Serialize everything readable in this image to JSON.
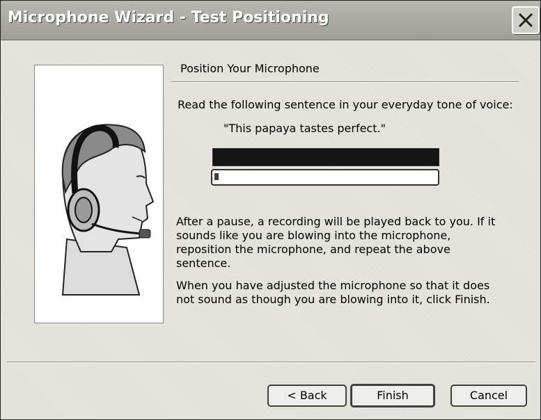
{
  "window": {
    "title": "Microphone Wizard - Test Positioning"
  },
  "page": {
    "section_title": "Position Your Microphone",
    "instruction": "Read the following sentence in your everyday tone of voice:",
    "sentence": "\"This papaya tastes perfect.\"",
    "volume_level": 1.0,
    "progress_level": 0.02,
    "paragraph_1": "After a pause, a recording will be played back to you. If it sounds like you are blowing into the microphone, reposition the microphone, and repeat the above sentence.",
    "paragraph_2": "When you have adjusted the microphone so that it does not sound as though you are blowing into it, click Finish."
  },
  "buttons": {
    "back": "< Back",
    "finish": "Finish",
    "cancel": "Cancel"
  },
  "icons": {
    "close": "close-icon",
    "illustration": "headset-head-illustration"
  }
}
